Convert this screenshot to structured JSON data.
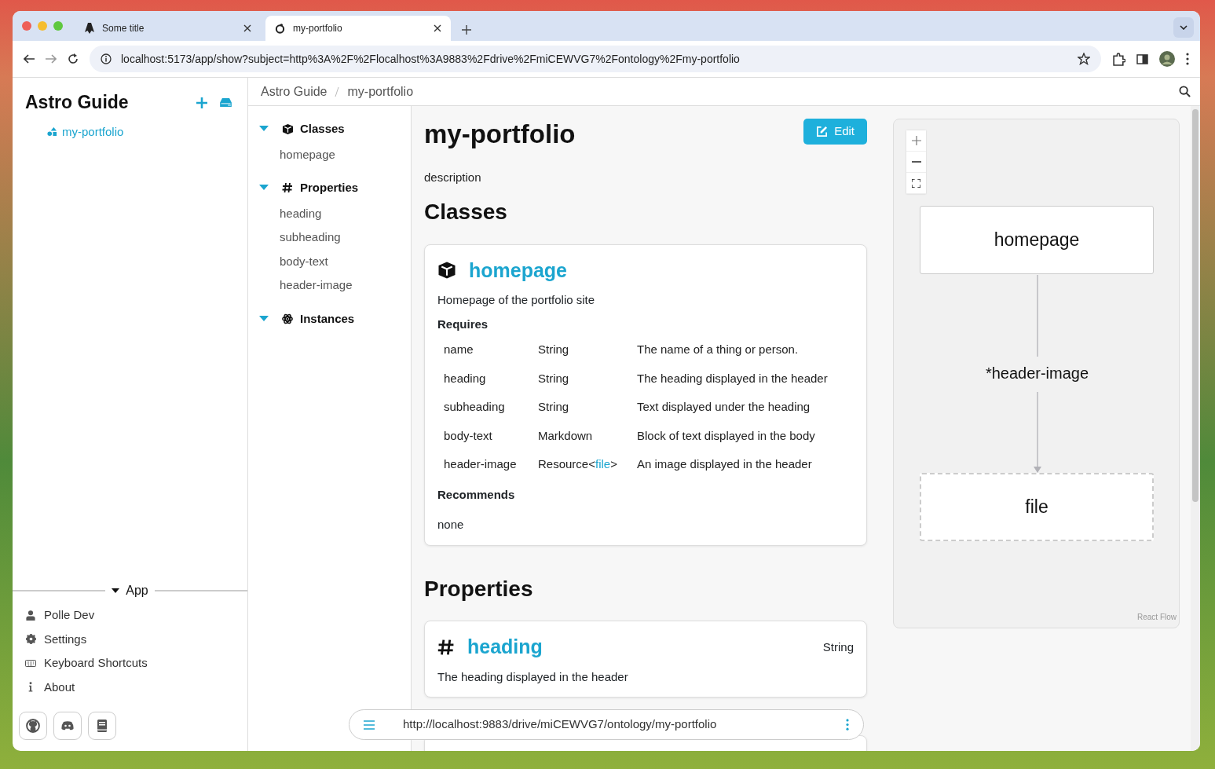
{
  "browser": {
    "tabs": [
      {
        "title": "Some title",
        "selected": false
      },
      {
        "title": "my-portfolio",
        "selected": true
      }
    ],
    "address": "localhost:5173/app/show?subject=http%3A%2F%2Flocalhost%3A9883%2Fdrive%2FmiCEWVG7%2Fontology%2Fmy-portfolio"
  },
  "sidebar": {
    "title": "Astro Guide",
    "items": [
      {
        "label": "my-portfolio"
      }
    ],
    "section": {
      "label": "App",
      "expanded": true
    },
    "menu": [
      {
        "label": "Polle Dev"
      },
      {
        "label": "Settings"
      },
      {
        "label": "Keyboard Shortcuts"
      },
      {
        "label": "About"
      }
    ]
  },
  "breadcrumb": [
    "Astro Guide",
    "my-portfolio"
  ],
  "outline": [
    {
      "title": "Classes",
      "expanded": true,
      "children": [
        "homepage"
      ]
    },
    {
      "title": "Properties",
      "expanded": true,
      "children": [
        "heading",
        "subheading",
        "body-text",
        "header-image"
      ]
    },
    {
      "title": "Instances",
      "expanded": true
    }
  ],
  "page": {
    "title": "my-portfolio",
    "edit_button": "Edit",
    "description": "description",
    "classes_heading": "Classes",
    "class_card": {
      "name": "homepage",
      "description": "Homepage of the portfolio site",
      "requires_label": "Requires",
      "requires": [
        {
          "name": "name",
          "type": "String",
          "description": "The name of a thing or person."
        },
        {
          "name": "heading",
          "type": "String",
          "description": "The heading displayed in the header"
        },
        {
          "name": "subheading",
          "type": "String",
          "description": "Text displayed under the heading"
        },
        {
          "name": "body-text",
          "type": "Markdown",
          "description": "Block of text displayed in the body"
        },
        {
          "name": "header-image",
          "type": "Resource<",
          "type_link": "file",
          "type_suffix": ">",
          "description": "An image displayed in the header"
        }
      ],
      "recommends_label": "Recommends",
      "recommends": "none"
    },
    "properties_heading": "Properties",
    "property_card": {
      "name": "heading",
      "type": "String",
      "description": "The heading displayed in the header"
    }
  },
  "graph": {
    "nodes": [
      {
        "label": "homepage",
        "kind": "class"
      },
      {
        "label": "file",
        "kind": "external"
      }
    ],
    "edge_label": "*header-image",
    "attribution": "React Flow"
  },
  "bottom_bar": {
    "url": "http://localhost:9883/drive/miCEWVG7/ontology/my-portfolio"
  }
}
